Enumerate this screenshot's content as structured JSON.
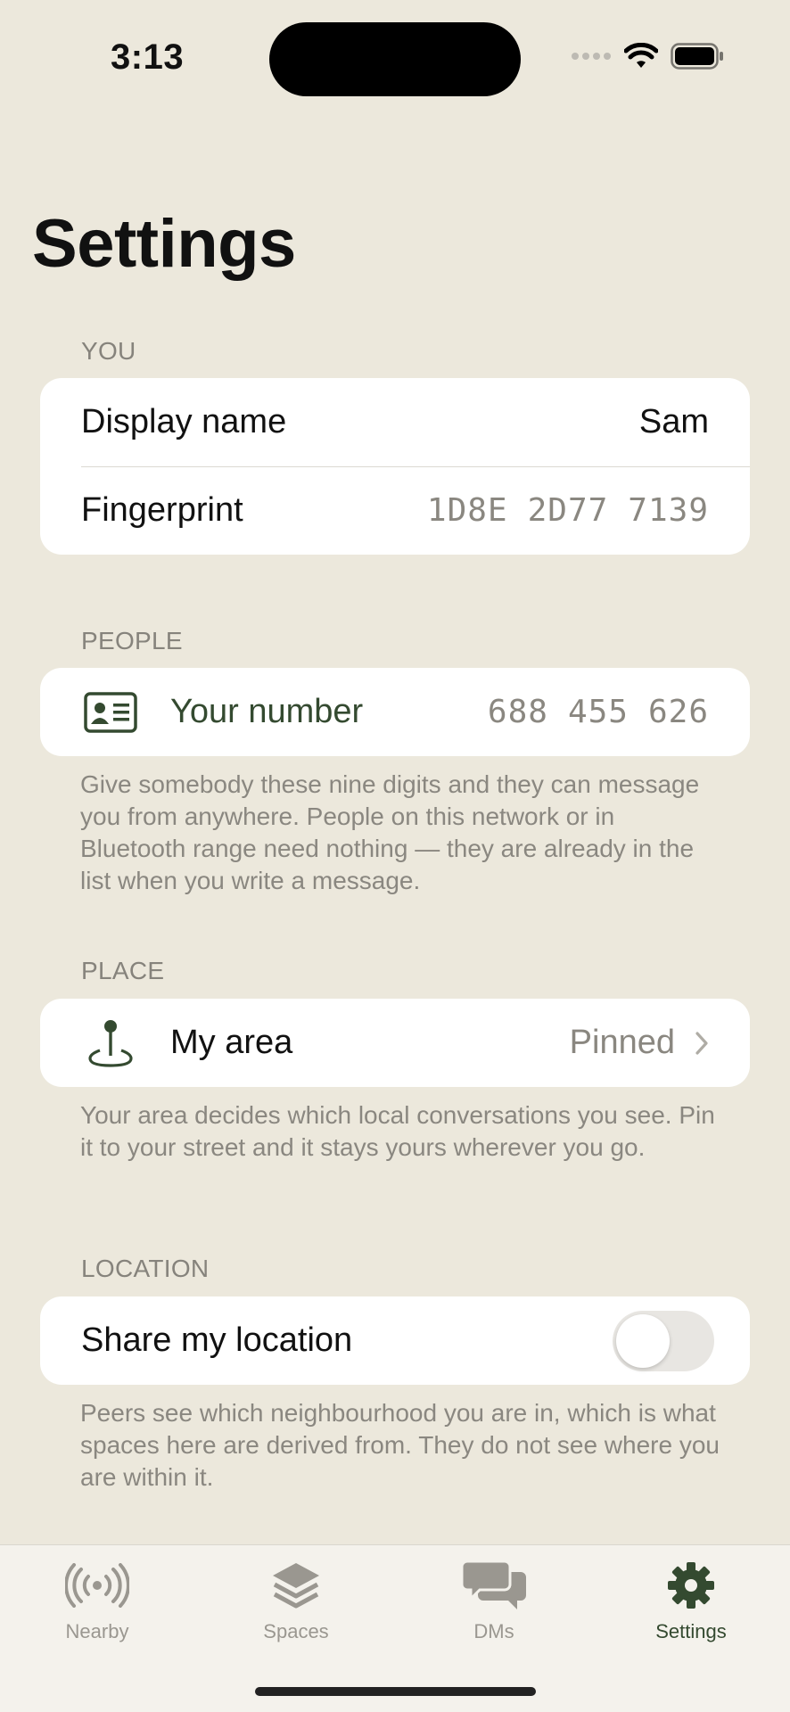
{
  "status": {
    "time": "3:13"
  },
  "page": {
    "title": "Settings"
  },
  "sections": {
    "you": {
      "header": "YOU",
      "display_name": {
        "label": "Display name",
        "value": "Sam"
      },
      "fingerprint": {
        "label": "Fingerprint",
        "groups": [
          "1D8E",
          "2D77",
          "7139"
        ]
      }
    },
    "people": {
      "header": "PEOPLE",
      "your_number": {
        "label": "Your number",
        "groups": [
          "688",
          "455",
          "626"
        ]
      },
      "footer": "Give somebody these nine digits and they can message you from anywhere. People on this network or in Bluetooth range need nothing — they are already in the list when you write a message."
    },
    "place": {
      "header": "PLACE",
      "my_area": {
        "label": "My area",
        "value": "Pinned"
      },
      "footer": "Your area decides which local conversations you see. Pin it to your street and it stays yours wherever you go."
    },
    "location": {
      "header": "LOCATION",
      "share": {
        "label": "Share my location",
        "enabled": false
      },
      "footer": "Peers see which neighbourhood you are in, which is what spaces here are derived from. They do not see where you are within it."
    }
  },
  "tabs": [
    {
      "label": "Nearby",
      "icon": "broadcast-icon",
      "active": false
    },
    {
      "label": "Spaces",
      "icon": "layers-icon",
      "active": false
    },
    {
      "label": "DMs",
      "icon": "chat-bubbles-icon",
      "active": false
    },
    {
      "label": "Settings",
      "icon": "gear-icon",
      "active": true
    }
  ],
  "colors": {
    "accent": "#344A30",
    "background": "#ECE8DC",
    "muted": "#8A8780"
  }
}
